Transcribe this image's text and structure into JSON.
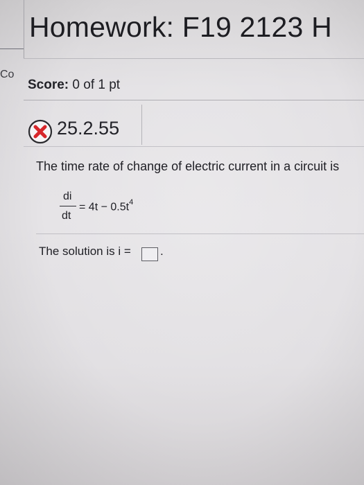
{
  "header": {
    "title": "Homework: F19 2123 H",
    "course_link": "Co"
  },
  "score": {
    "label": "Score:",
    "value": "0 of 1 pt"
  },
  "question": {
    "id": "25.2.55",
    "status_icon": "x-icon",
    "status_color": "#d7262a"
  },
  "problem": {
    "prompt": "The time rate of change of electric current in a circuit is",
    "equation": {
      "numerator": "di",
      "denominator": "dt",
      "rhs_main": "= 4t − 0.5t",
      "rhs_exponent": "4"
    },
    "solution_label": "The solution is i =",
    "answer_value": "",
    "trailing": "."
  }
}
